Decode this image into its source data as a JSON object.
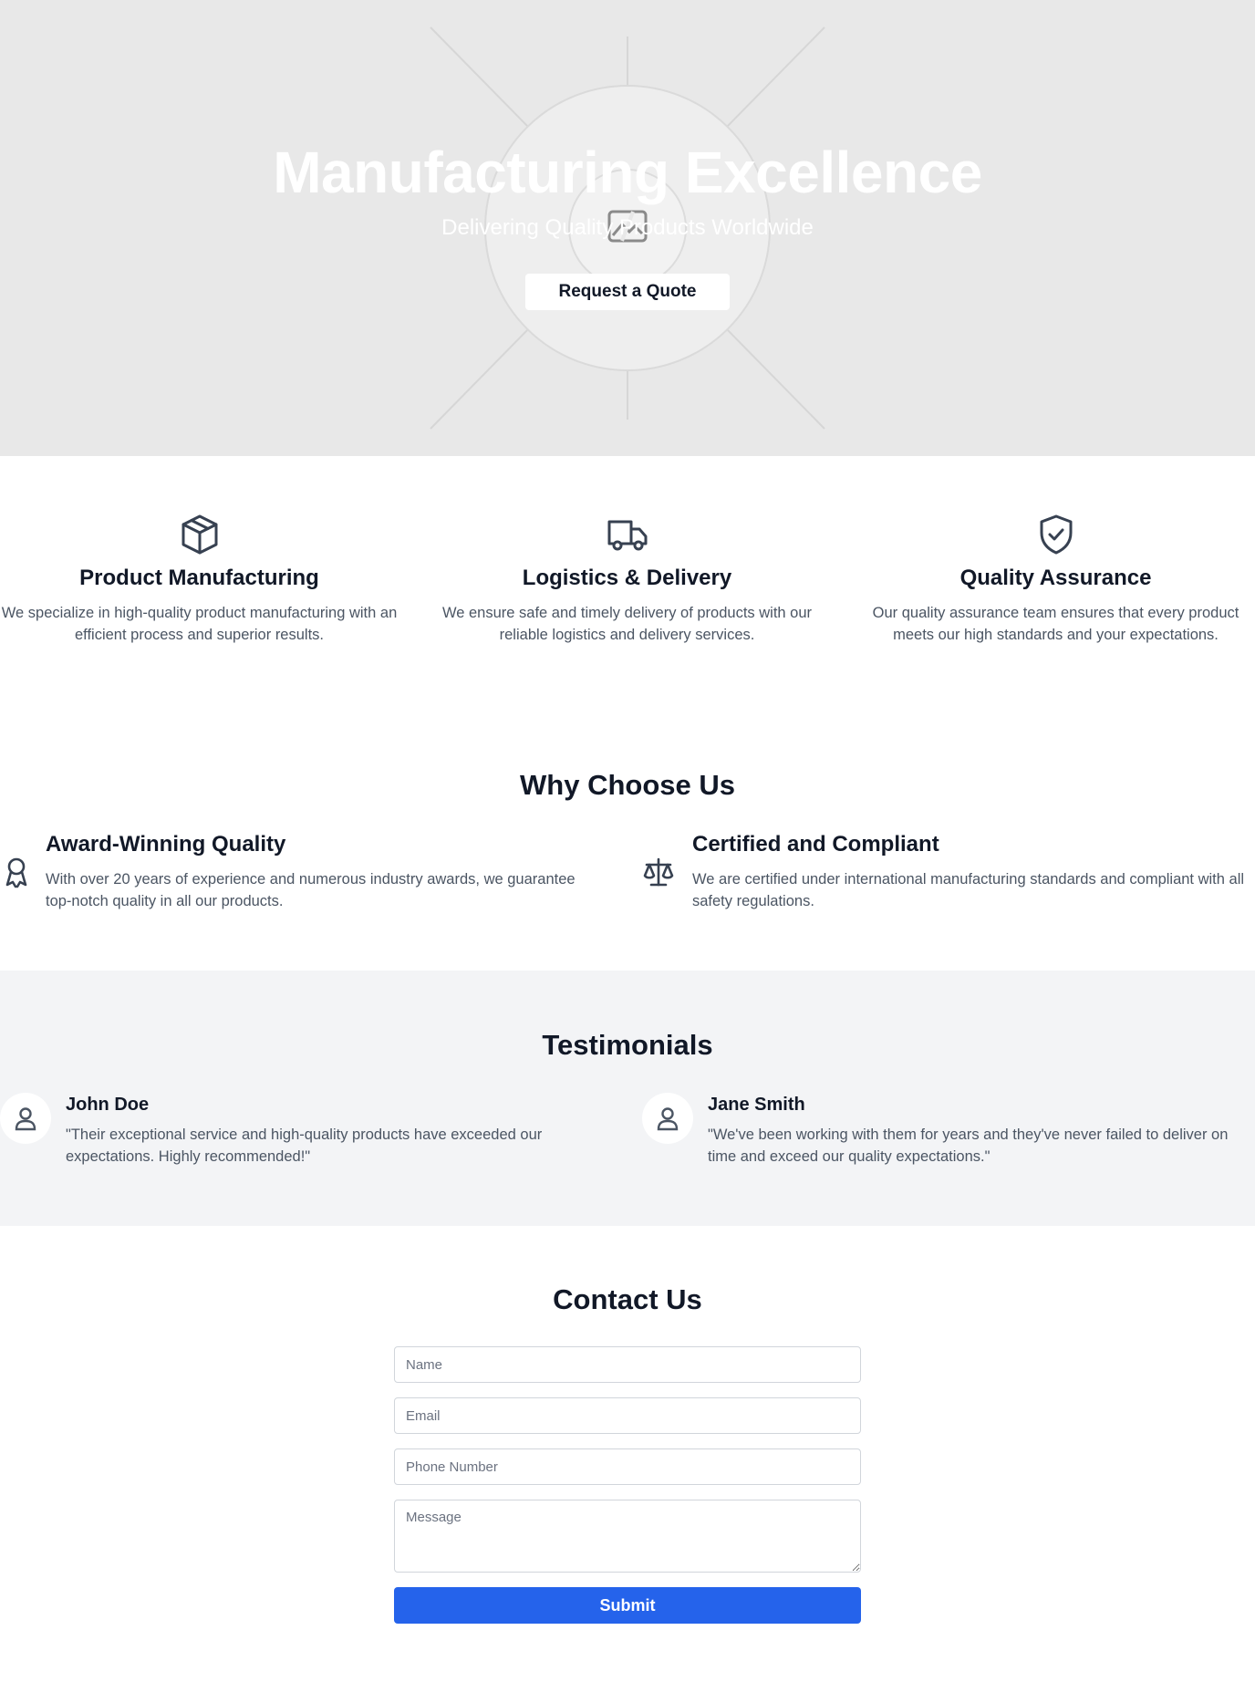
{
  "hero": {
    "title": "Manufacturing Excellence",
    "subtitle": "Delivering Quality Products Worldwide",
    "cta_label": "Request a Quote",
    "background_color": "#e8e8e8",
    "image_icon": "broken-image-icon"
  },
  "services": [
    {
      "icon": "package-box-icon",
      "title": "Product Manufacturing",
      "description": "We specialize in high-quality product manufacturing with an efficient process and superior results."
    },
    {
      "icon": "delivery-truck-icon",
      "title": "Logistics & Delivery",
      "description": "We ensure safe and timely delivery of products with our reliable logistics and delivery services."
    },
    {
      "icon": "shield-check-icon",
      "title": "Quality Assurance",
      "description": "Our quality assurance team ensures that every product meets our high standards and your expectations."
    }
  ],
  "why": {
    "title": "Why Choose Us",
    "features": [
      {
        "icon": "award-ribbon-icon",
        "title": "Award-Winning Quality",
        "description": "With over 20 years of experience and numerous industry awards, we guarantee top-notch quality in all our products."
      },
      {
        "icon": "scales-icon",
        "title": "Certified and Compliant",
        "description": "We are certified under international manufacturing standards and compliant with all safety regulations."
      }
    ]
  },
  "testimonials": {
    "title": "Testimonials",
    "background_color": "#f3f4f6",
    "items": [
      {
        "name": "John Doe",
        "quote": "\"Their exceptional service and high-quality products have exceeded our expectations. Highly recommended!\""
      },
      {
        "name": "Jane Smith",
        "quote": "\"We've been working with them for years and they've never failed to deliver on time and exceed our quality expectations.\""
      }
    ]
  },
  "contact": {
    "title": "Contact Us",
    "name_placeholder": "Name",
    "email_placeholder": "Email",
    "phone_placeholder": "Phone Number",
    "message_placeholder": "Message",
    "submit_label": "Submit",
    "submit_color": "#2563eb"
  }
}
